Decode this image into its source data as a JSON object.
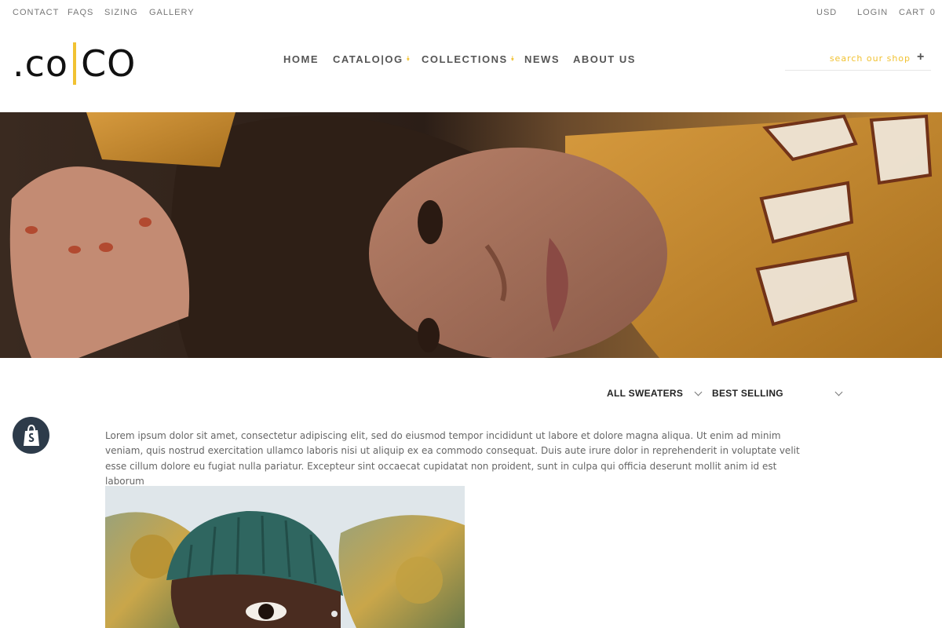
{
  "topbar": {
    "left_links": [
      "CONTACT",
      "FAQS",
      "SIZING",
      "GALLERY"
    ],
    "currency": "USD",
    "login": "LOGIN",
    "cart_label": "CART",
    "cart_count": "0"
  },
  "header": {
    "logo_left": ".CO",
    "logo_right": "CO",
    "nav": [
      {
        "label": "HOME",
        "has_dropdown": false
      },
      {
        "label": "CATALO|OG",
        "has_dropdown": true
      },
      {
        "label": "COLLECTIONS",
        "has_dropdown": true
      },
      {
        "label": "NEWS",
        "has_dropdown": false
      },
      {
        "label": "ABOUT US",
        "has_dropdown": false
      }
    ],
    "search_placeholder": "search our shop",
    "search_button": "+"
  },
  "filters": {
    "category": "ALL SWEATERS",
    "sort": "BEST SELLING"
  },
  "collection": {
    "description": "Lorem ipsum dolor sit amet, consectetur adipiscing elit, sed do eiusmod tempor incididunt ut labore et dolore magna aliqua. Ut enim ad minim veniam, quis nostrud exercitation ullamco laboris nisi ut aliquip ex ea commodo consequat. Duis aute irure dolor in reprehenderit in voluptate velit esse cillum dolore eu fugiat nulla pariatur. Excepteur sint occaecat cupidatat non proident, sunt in culpa qui officia deserunt mollit anim id est laborum"
  },
  "colors": {
    "accent": "#f1c232",
    "nav_text": "#555555",
    "shopify_badge": "#2d3b4a"
  },
  "icons": {
    "nav_dropdown": "chevron-double-down-icon",
    "filter_dropdown": "chevron-down-icon",
    "shopify": "shopify-bag-icon",
    "search_submit": "plus-icon"
  }
}
